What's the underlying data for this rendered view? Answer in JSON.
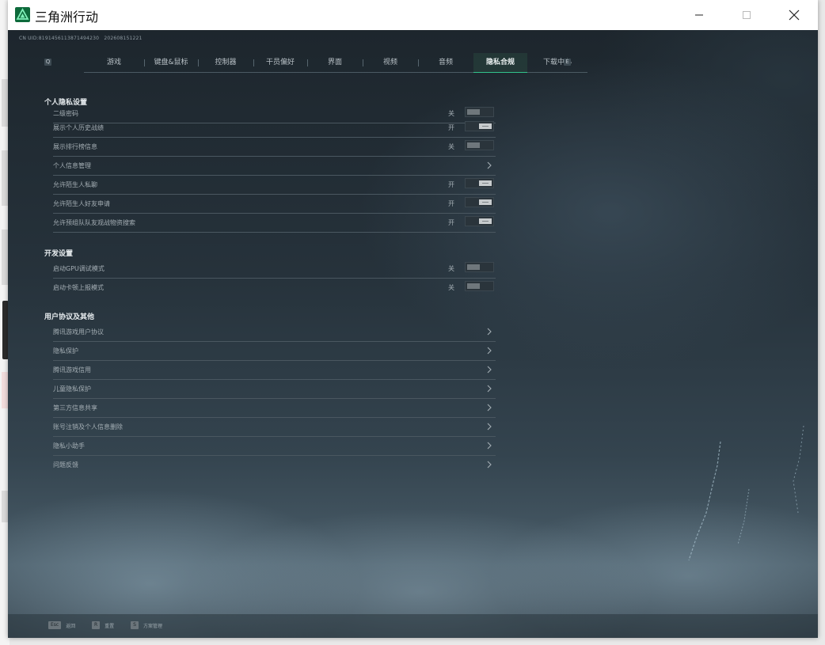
{
  "window": {
    "title": "三角洲行动",
    "minimize_label": "minimize-icon",
    "maximize_label": "maximize-icon",
    "close_label": "close-icon"
  },
  "uid_text": "CN UID:8191456113871494230　202608151221",
  "tabs": {
    "prev_key": "Q",
    "next_key": "E",
    "items": [
      {
        "label": "游戏",
        "active": false
      },
      {
        "label": "键盘&鼠标",
        "active": false
      },
      {
        "label": "控制器",
        "active": false
      },
      {
        "label": "干员偏好",
        "active": false
      },
      {
        "label": "界面",
        "active": false
      },
      {
        "label": "视频",
        "active": false
      },
      {
        "label": "音频",
        "active": false
      },
      {
        "label": "隐私合规",
        "active": true
      },
      {
        "label": "下载中心",
        "active": false
      }
    ]
  },
  "sections": {
    "privacy": {
      "title": "个人隐私设置",
      "rows": [
        {
          "label": "二级密码",
          "state": "关",
          "on": false
        },
        {
          "label": "展示个人历史战绩",
          "state": "开",
          "on": true
        },
        {
          "label": "展示排行榜信息",
          "state": "关",
          "on": false
        },
        {
          "label": "个人信息管理",
          "state": "",
          "on": null
        },
        {
          "label": "允许陌生人私聊",
          "state": "开",
          "on": true
        },
        {
          "label": "允许陌生人好友申请",
          "state": "开",
          "on": true
        },
        {
          "label": "允许预组队队友观战物资搜索",
          "state": "开",
          "on": true
        }
      ]
    },
    "dev": {
      "title": "开发设置",
      "rows": [
        {
          "label": "启动GPU调试模式",
          "state": "关",
          "on": false
        },
        {
          "label": "启动卡顿上报模式",
          "state": "关",
          "on": false
        }
      ]
    },
    "agreements": {
      "title": "用户协议及其他",
      "rows": [
        {
          "label": "腾讯游戏用户协议"
        },
        {
          "label": "隐私保护"
        },
        {
          "label": "腾讯游戏信用"
        },
        {
          "label": "儿童隐私保护"
        },
        {
          "label": "第三方信息共享"
        },
        {
          "label": "账号注销及个人信息删除"
        },
        {
          "label": "隐私小助手"
        },
        {
          "label": "问题反馈"
        }
      ]
    }
  },
  "footer": {
    "hints": [
      {
        "key": "Esc",
        "label": "返回"
      },
      {
        "key": "R",
        "label": "重置"
      },
      {
        "key": "S",
        "label": "方案管理"
      }
    ]
  },
  "colors": {
    "accent": "#32c28c",
    "toggle_on": "#c7cbcd",
    "toggle_off": "#6f777c"
  }
}
